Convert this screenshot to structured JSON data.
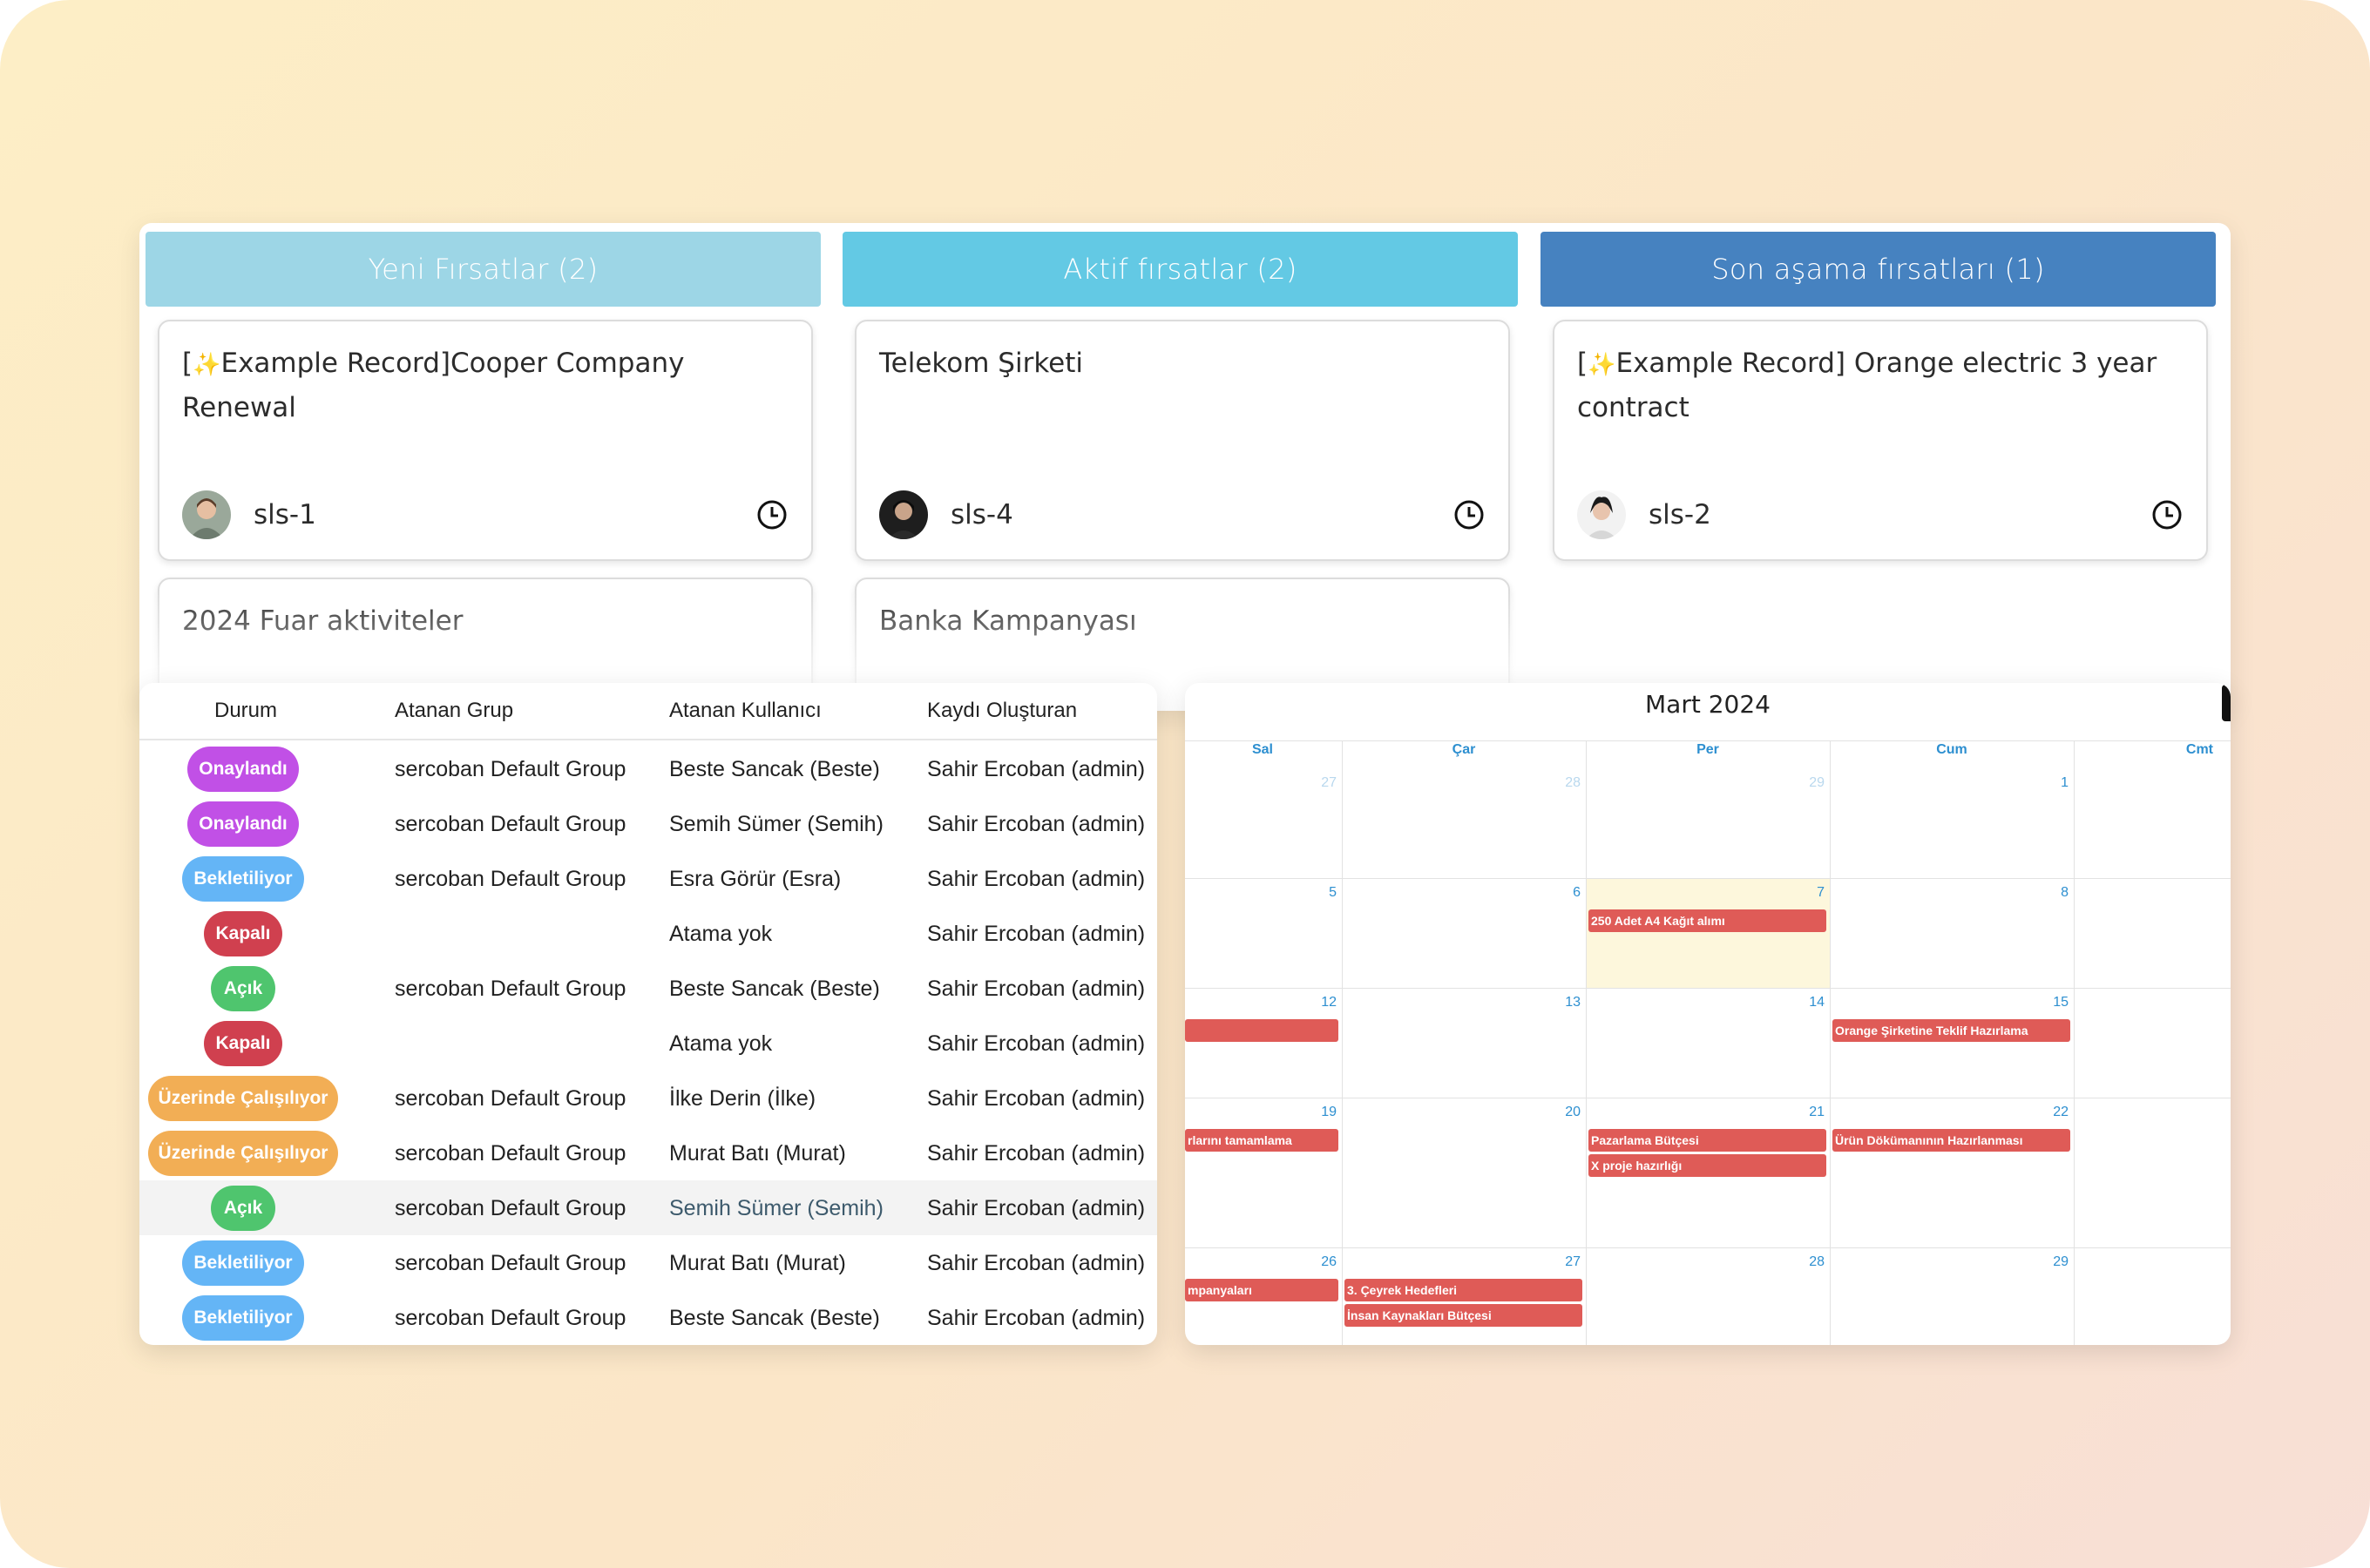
{
  "kanban": {
    "columns": [
      {
        "title": "Yeni Fırsatlar (2)",
        "color": "#9dd6e6"
      },
      {
        "title": "Aktif fırsatlar (2)",
        "color": "#63c9e4"
      },
      {
        "title": "Son aşama fırsatları (1)",
        "color": "#4682c0"
      }
    ],
    "cards": [
      {
        "prefix": "[",
        "icon": "sparkle-icon",
        "title": "Example Record]Cooper Company Renewal",
        "code": "sls-1"
      },
      {
        "prefix": "",
        "icon": "",
        "title": "Telekom Şirketi",
        "code": "sls-4"
      },
      {
        "prefix": "[",
        "icon": "sparkle-icon",
        "title": "Example Record] Orange electric 3 year contract",
        "code": "sls-2"
      },
      {
        "prefix": "",
        "icon": "",
        "title": "2024 Fuar aktiviteler",
        "code": ""
      },
      {
        "prefix": "",
        "icon": "",
        "title": "Banka Kampanyası",
        "code": ""
      }
    ]
  },
  "table": {
    "headers": [
      "Durum",
      "Atanan Grup",
      "Atanan Kullanıcı",
      "Kaydı Oluşturan"
    ],
    "status_colors": {
      "Onaylandı": "#c150e6",
      "Bekletiliyor": "#64b5f6",
      "Kapalı": "#d0404f",
      "Açık": "#4fc56e",
      "Üzerinde Çalışılıyor": "#f2ae55"
    },
    "rows": [
      {
        "status": "Onaylandı",
        "group": "sercoban Default Group",
        "user": "Beste Sancak (Beste)",
        "creator": "Sahir Ercoban (admin)"
      },
      {
        "status": "Onaylandı",
        "group": "sercoban Default Group",
        "user": "Semih Sümer (Semih)",
        "creator": "Sahir Ercoban (admin)"
      },
      {
        "status": "Bekletiliyor",
        "group": "sercoban Default Group",
        "user": "Esra Görür (Esra)",
        "creator": "Sahir Ercoban (admin)"
      },
      {
        "status": "Kapalı",
        "group": "",
        "user": "Atama yok",
        "creator": "Sahir Ercoban (admin)"
      },
      {
        "status": "Açık",
        "group": "sercoban Default Group",
        "user": "Beste Sancak (Beste)",
        "creator": "Sahir Ercoban (admin)"
      },
      {
        "status": "Kapalı",
        "group": "",
        "user": "Atama yok",
        "creator": "Sahir Ercoban (admin)"
      },
      {
        "status": "Üzerinde Çalışılıyor",
        "group": "sercoban Default Group",
        "user": "İlke Derin (İlke)",
        "creator": "Sahir Ercoban (admin)"
      },
      {
        "status": "Üzerinde Çalışılıyor",
        "group": "sercoban Default Group",
        "user": "Murat Batı (Murat)",
        "creator": "Sahir Ercoban (admin)"
      },
      {
        "status": "Açık",
        "group": "sercoban Default Group",
        "user": "Semih Sümer (Semih)",
        "creator": "Sahir Ercoban (admin)"
      },
      {
        "status": "Bekletiliyor",
        "group": "sercoban Default Group",
        "user": "Murat Batı (Murat)",
        "creator": "Sahir Ercoban (admin)"
      },
      {
        "status": "Bekletiliyor",
        "group": "sercoban Default Group",
        "user": "Beste Sancak (Beste)",
        "creator": "Sahir Ercoban (admin)"
      }
    ]
  },
  "calendar": {
    "title": "Mart 2024",
    "weekdays": [
      "Sal",
      "Çar",
      "Per",
      "Cum",
      "Cmt"
    ],
    "weeks": [
      [
        "27",
        "28",
        "29",
        "1",
        ""
      ],
      [
        "5",
        "6",
        "7",
        "8",
        ""
      ],
      [
        "12",
        "13",
        "14",
        "15",
        ""
      ],
      [
        "19",
        "20",
        "21",
        "22",
        ""
      ],
      [
        "26",
        "27",
        "28",
        "29",
        ""
      ]
    ],
    "events": [
      {
        "label": "250 Adet A4 Kağıt alımı",
        "week": 1,
        "day": 2,
        "slot": 0
      },
      {
        "label": "",
        "week": 2,
        "day": 0,
        "slot": 0
      },
      {
        "label": "Orange Şirketine Teklif Hazırlama",
        "week": 2,
        "day": 3,
        "slot": 0
      },
      {
        "label": "rlarını tamamlama",
        "week": 3,
        "day": 0,
        "slot": 0
      },
      {
        "label": "Pazarlama Bütçesi",
        "week": 3,
        "day": 2,
        "slot": 0
      },
      {
        "label": "X proje hazırlığı",
        "week": 3,
        "day": 2,
        "slot": 1
      },
      {
        "label": "Ürün Dökümanının Hazırlanması",
        "week": 3,
        "day": 3,
        "slot": 0
      },
      {
        "label": "mpanyaları",
        "week": 4,
        "day": 0,
        "slot": 0
      },
      {
        "label": "3. Çeyrek Hedefleri",
        "week": 4,
        "day": 1,
        "slot": 0
      },
      {
        "label": "İnsan Kaynakları Bütçesi",
        "week": 4,
        "day": 1,
        "slot": 1
      }
    ]
  }
}
